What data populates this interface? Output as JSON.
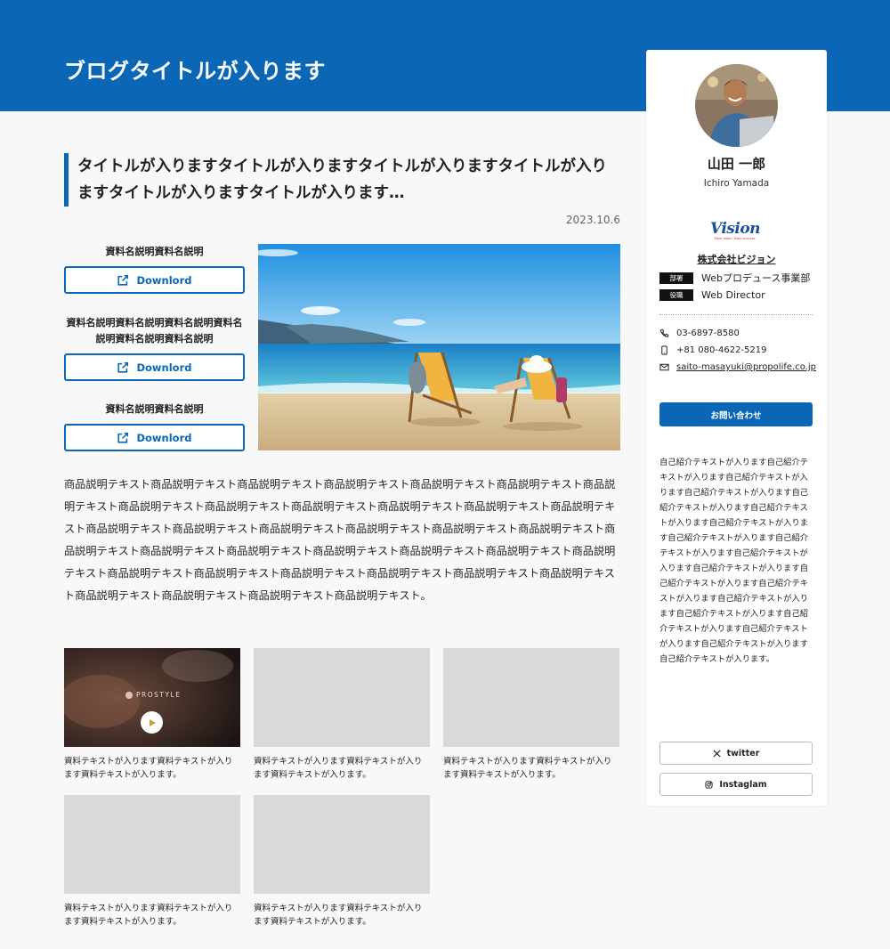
{
  "header": {
    "blog_title": "ブログタイトルが入ります"
  },
  "article": {
    "title": "タイトルが入りますタイトルが入りますタイトルが入りますタイトルが入りますタイトルが入りますタイトルが入ります…",
    "date": "2023.10.6",
    "downloads": [
      {
        "label": "資料名説明資料名説明",
        "button": "Downlord"
      },
      {
        "label": "資料名説明資料名説明資料名説明資料名説明資料名説明資料名説明",
        "button": "Downlord"
      },
      {
        "label": "資料名説明資料名説明",
        "button": "Downlord"
      }
    ],
    "body": "商品説明テキスト商品説明テキスト商品説明テキスト商品説明テキスト商品説明テキスト商品説明テキスト商品説明テキスト商品説明テキスト商品説明テキスト商品説明テキスト商品説明テキスト商品説明テキスト商品説明テキスト商品説明テキスト商品説明テキスト商品説明テキスト商品説明テキスト商品説明テキスト商品説明テキスト商品説明テキスト商品説明テキスト商品説明テキスト商品説明テキスト商品説明テキスト商品説明テキスト商品説明テキスト商品説明テキスト商品説明テキスト商品説明テキスト商品説明テキスト商品説明テキスト商品説明テキスト商品説明テキスト商品説明テキスト商品説明テキスト商品説明テキスト。"
  },
  "cards": [
    {
      "text": "資料テキストが入ります資料テキストが入ります資料テキストが入ります。",
      "video_brand": "PROSTYLE"
    },
    {
      "text": "資料テキストが入ります資料テキストが入ります資料テキストが入ります。"
    },
    {
      "text": "資料テキストが入ります資料テキストが入ります資料テキストが入ります。"
    },
    {
      "text": "資料テキストが入ります資料テキストが入ります資料テキストが入ります。"
    },
    {
      "text": "資料テキストが入ります資料テキストが入ります資料テキストが入ります。"
    }
  ],
  "profile": {
    "name": "山田 一郎",
    "romaji": "Ichiro Yamada",
    "logo_text": "Vision",
    "logo_tagline": "More vision. More success.",
    "company": "株式会社ビジョン",
    "department_tag": "部署",
    "department": "Webプロデュース事業部",
    "role_tag": "役職",
    "role": "Web Director",
    "phone": "03-6897-8580",
    "mobile": "+81 080-4622-5219",
    "email": "saito-masayuki@propolife.co.jp",
    "inquiry_label": "お問い合わせ",
    "intro": "自己紹介テキストが入ります自己紹介テキストが入ります自己紹介テキストが入ります自己紹介テキストが入ります自己紹介テキストが入ります自己紹介テキストが入ります自己紹介テキストが入ります自己紹介テキストが入ります自己紹介テキストが入ります自己紹介テキストが入ります自己紹介テキストが入ります自己紹介テキストが入ります自己紹介テキストが入ります自己紹介テキストが入ります自己紹介テキストが入ります自己紹介テキストが入ります自己紹介テキストが入ります自己紹介テキストが入ります自己紹介テキストが入ります。",
    "twitter_label": "twitter",
    "instagram_label": "Instaglam"
  },
  "colors": {
    "brand_blue": "#0b67b6",
    "page_bg": "#f8f8f8",
    "placeholder_gray": "#d9d9d9"
  }
}
